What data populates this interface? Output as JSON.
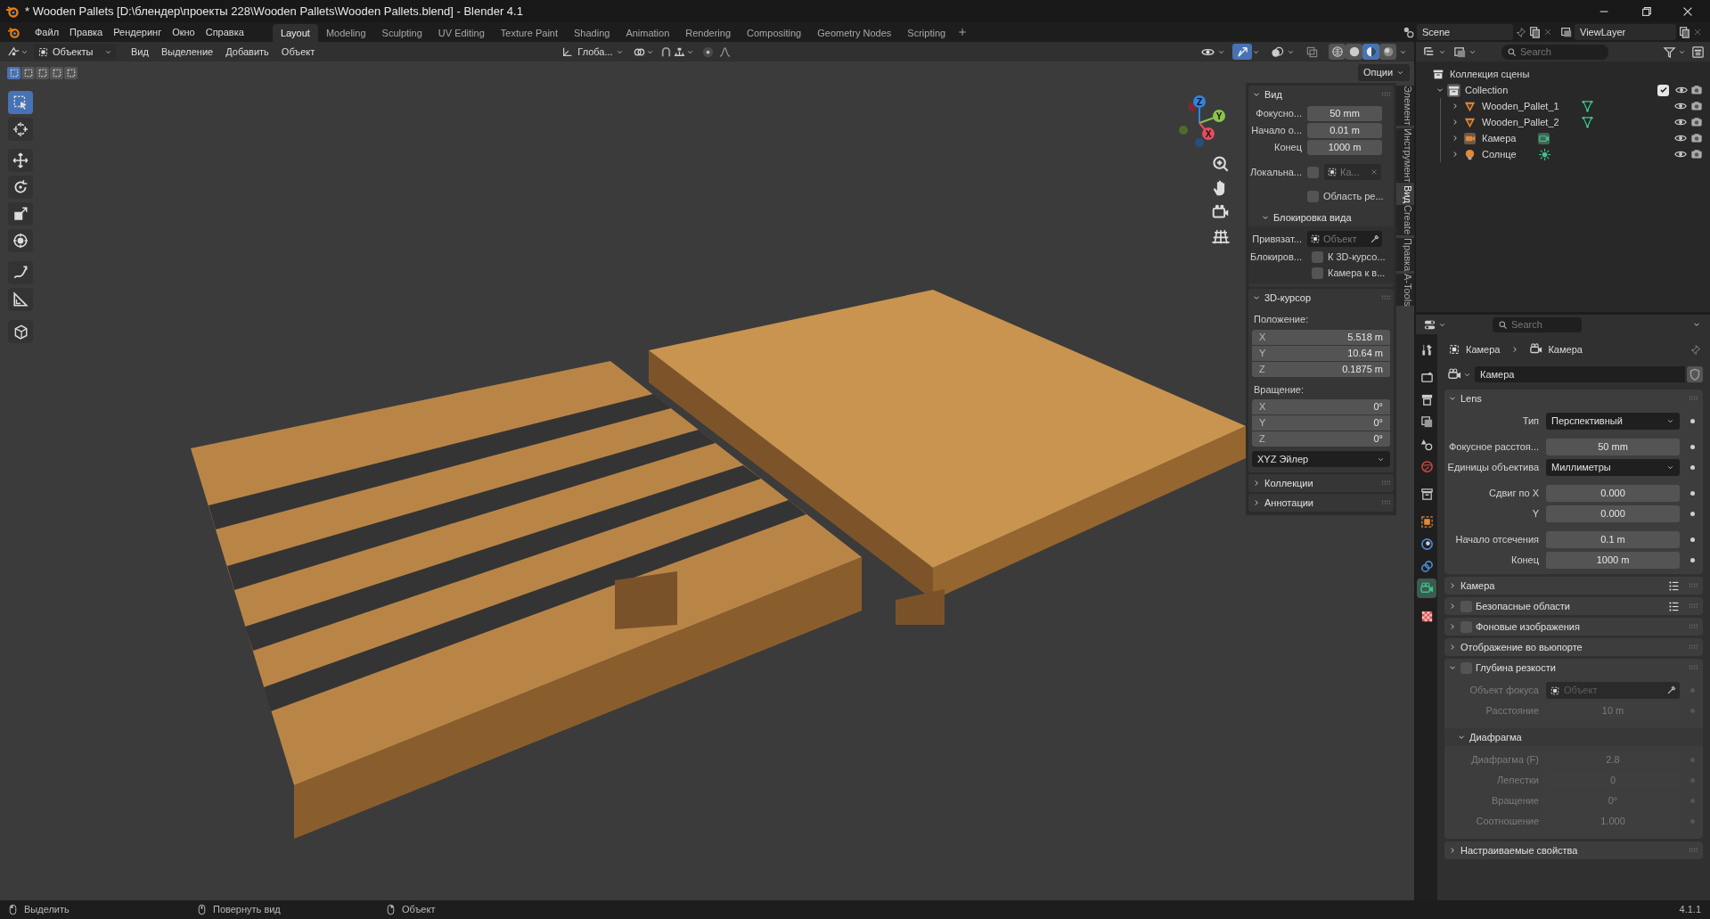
{
  "title_bar": {
    "title": "* Wooden Pallets [D:\\блендер\\проекты 228\\Wooden Pallets\\Wooden Pallets.blend] - Blender 4.1"
  },
  "menu": [
    "Файл",
    "Правка",
    "Рендеринг",
    "Окно",
    "Справка"
  ],
  "workspaces": [
    {
      "label": "Layout",
      "selected": true
    },
    {
      "label": "Modeling",
      "selected": false
    },
    {
      "label": "Sculpting",
      "selected": false
    },
    {
      "label": "UV Editing",
      "selected": false
    },
    {
      "label": "Texture Paint",
      "selected": false
    },
    {
      "label": "Shading",
      "selected": false
    },
    {
      "label": "Animation",
      "selected": false
    },
    {
      "label": "Rendering",
      "selected": false
    },
    {
      "label": "Compositing",
      "selected": false
    },
    {
      "label": "Geometry Nodes",
      "selected": false
    },
    {
      "label": "Scripting",
      "selected": false
    }
  ],
  "scene": {
    "name": "Scene"
  },
  "view_layer": {
    "name": "ViewLayer"
  },
  "viewport": {
    "mode": "Объекты",
    "menus": [
      "Вид",
      "Выделение",
      "Добавить",
      "Объект"
    ],
    "orientation": "Глоба...",
    "options": "Опции",
    "select_modes": [
      {
        "selected": true
      },
      {
        "selected": false
      },
      {
        "selected": false
      },
      {
        "selected": false
      },
      {
        "selected": false
      }
    ],
    "header_toggles": [
      {
        "kind": "visibility",
        "selected": false
      },
      {
        "kind": "gizmo",
        "selected": true
      },
      {
        "kind": "overlay",
        "selected": false
      },
      {
        "kind": "xray",
        "selected": false
      }
    ],
    "shading": [
      {
        "kind": "wireframe",
        "selected": false
      },
      {
        "kind": "solid",
        "selected": false
      },
      {
        "kind": "material",
        "selected": true
      },
      {
        "kind": "rendered",
        "selected": false
      }
    ],
    "tools": [
      {
        "kind": "select",
        "selected": true
      },
      {
        "kind": "cursor",
        "selected": false
      },
      {
        "kind": "move",
        "selected": false
      },
      {
        "kind": "rotate",
        "selected": false
      },
      {
        "kind": "scale",
        "selected": false
      },
      {
        "kind": "transform",
        "selected": false
      },
      {
        "kind": "annotate",
        "selected": false
      },
      {
        "kind": "measure",
        "selected": false
      },
      {
        "kind": "add_cube",
        "selected": false
      }
    ],
    "gizmo_axes": [
      {
        "label": "Z",
        "color": "#2f83e3"
      },
      {
        "label": "Y",
        "color": "#8bc34a"
      },
      {
        "label": "X",
        "color": "#e84a5f"
      }
    ]
  },
  "sidebar": {
    "tabs": [
      {
        "label": "Элемент",
        "selected": false
      },
      {
        "label": "Инструмент",
        "selected": false
      },
      {
        "label": "Вид",
        "selected": true
      },
      {
        "label": "Create",
        "selected": false
      },
      {
        "label": "Правка",
        "selected": false
      },
      {
        "label": "A-Tools",
        "selected": false
      }
    ],
    "view": {
      "title": "Вид",
      "expanded": true,
      "fields": [
        {
          "label": "Фокусно...",
          "value": "50 mm"
        },
        {
          "label": "Начало о...",
          "value": "0.01 m"
        },
        {
          "label": "Конец",
          "value": "1000 m"
        }
      ],
      "local_camera": {
        "label": "Локальна...",
        "checked": false,
        "placeholder": "Ка..."
      },
      "render_region": {
        "label": "Область ре...",
        "checked": false
      },
      "lock": {
        "title": "Блокировка вида",
        "expanded": true,
        "object_label": "Привязат...",
        "object_placeholder": "Объект",
        "lock_label": "Блокиров...",
        "options": [
          {
            "label": "К 3D-курсо...",
            "checked": false
          },
          {
            "label": "Камера к в...",
            "checked": false
          }
        ]
      }
    },
    "cursor": {
      "title": "3D-курсор",
      "expanded": true,
      "location_label": "Положение:",
      "location": [
        {
          "axis": "X",
          "value": "5.518 m"
        },
        {
          "axis": "Y",
          "value": "10.64 m"
        },
        {
          "axis": "Z",
          "value": "0.1875 m"
        }
      ],
      "rotation_label": "Вращение:",
      "rotation": [
        {
          "axis": "X",
          "value": "0°"
        },
        {
          "axis": "Y",
          "value": "0°"
        },
        {
          "axis": "Z",
          "value": "0°"
        }
      ],
      "rotation_mode": "XYZ Эйлер"
    },
    "collapsed_panels": [
      {
        "title": "Коллекции",
        "expanded": false
      },
      {
        "title": "Аннотации",
        "expanded": false
      }
    ]
  },
  "outliner": {
    "search": {
      "placeholder": "Search"
    },
    "root": "Коллекция сцены",
    "collection": {
      "name": "Collection",
      "expanded": true,
      "checked": true,
      "children": [
        {
          "name": "Wooden_Pallet_1",
          "kind": "mesh",
          "expanded": false
        },
        {
          "name": "Wooden_Pallet_2",
          "kind": "mesh",
          "expanded": false
        },
        {
          "name": "Камера",
          "kind": "camera",
          "expanded": false
        },
        {
          "name": "Солнце",
          "kind": "light",
          "expanded": false
        }
      ]
    }
  },
  "properties": {
    "search": {
      "placeholder": "Search"
    },
    "tabs": [
      {
        "kind": "tool",
        "selected": false
      },
      {
        "kind": "render",
        "selected": false
      },
      {
        "kind": "output",
        "selected": false
      },
      {
        "kind": "view_layer",
        "selected": false
      },
      {
        "kind": "scene",
        "selected": false
      },
      {
        "kind": "world",
        "selected": false
      },
      {
        "kind": "collection",
        "selected": false
      },
      {
        "kind": "object",
        "selected": false
      },
      {
        "kind": "physics",
        "selected": false
      },
      {
        "kind": "constraints",
        "selected": false
      },
      {
        "kind": "camera_data",
        "selected": true
      },
      {
        "kind": "texture",
        "selected": false
      }
    ],
    "breadcrumb": [
      "Камера",
      "Камера"
    ],
    "datablock": {
      "name": "Камера"
    },
    "panels": [
      {
        "title": "Lens",
        "expanded": true,
        "groups": [
          [
            {
              "kind": "dropdown",
              "label": "Тип",
              "value": "Перспективный"
            }
          ],
          [
            {
              "kind": "number",
              "label": "Фокусное расстоя...",
              "value": "50 mm"
            },
            {
              "kind": "dropdown",
              "label": "Единицы объектива",
              "value": "Миллиметры"
            }
          ],
          [
            {
              "kind": "number",
              "label": "Сдвиг по X",
              "value": "0.000"
            },
            {
              "kind": "number",
              "label": "Y",
              "value": "0.000"
            }
          ],
          [
            {
              "kind": "number",
              "label": "Начало отсечения",
              "value": "0.1 m"
            },
            {
              "kind": "number",
              "label": "Конец",
              "value": "1000 m"
            }
          ]
        ]
      },
      {
        "title": "Камера",
        "expanded": false,
        "presets": true
      },
      {
        "title": "Безопасные области",
        "expanded": false,
        "checked": false,
        "presets": true
      },
      {
        "title": "Фоновые изображения",
        "expanded": false,
        "checked": false
      },
      {
        "title": "Отображение во вьюпорте",
        "expanded": false
      },
      {
        "title": "Глубина резкости",
        "expanded": true,
        "checked": false,
        "groups": [
          [
            {
              "kind": "object",
              "label": "Объект фокуса",
              "placeholder": "Объект",
              "disabled": true
            },
            {
              "kind": "number",
              "label": "Расстояние",
              "value": "10 m",
              "disabled": true
            }
          ]
        ],
        "subpanels": [
          {
            "title": "Диафрагма",
            "expanded": true,
            "groups": [
              [
                {
                  "kind": "number",
                  "label": "Диафрагма (F)",
                  "value": "2.8",
                  "disabled": true
                },
                {
                  "kind": "number",
                  "label": "Лепестки",
                  "value": "0",
                  "disabled": true
                },
                {
                  "kind": "number",
                  "label": "Вращение",
                  "value": "0°",
                  "disabled": true
                },
                {
                  "kind": "number",
                  "label": "Соотношение",
                  "value": "1.000",
                  "disabled": true
                }
              ]
            ]
          }
        ]
      },
      {
        "title": "Настраиваемые свойства",
        "expanded": false
      }
    ]
  },
  "status_bar": {
    "hints": [
      {
        "kind": "left_click",
        "label": "Выделить"
      },
      {
        "kind": "middle_click",
        "label": "Повернуть вид"
      },
      {
        "kind": "right_click",
        "label": "Объект"
      }
    ],
    "version": "4.1.1"
  }
}
